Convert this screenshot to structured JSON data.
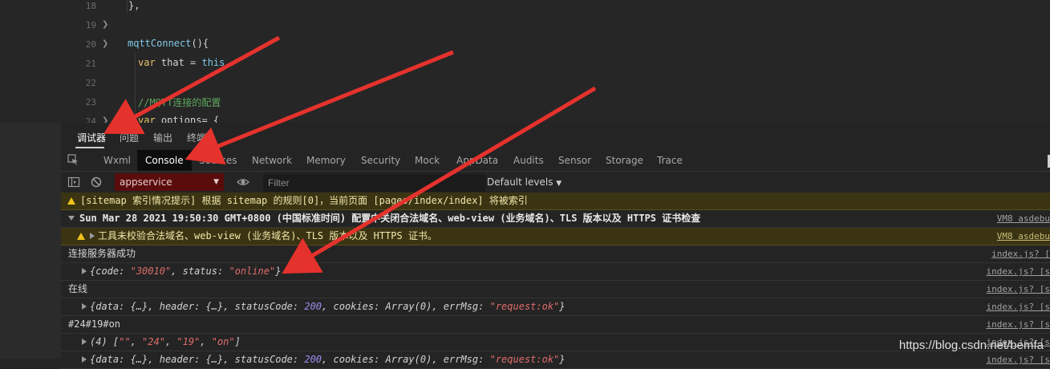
{
  "editor": {
    "lines": [
      {
        "num": "18",
        "fold": false
      },
      {
        "num": "19",
        "fold": true
      },
      {
        "num": "20",
        "fold": true
      },
      {
        "num": "21",
        "fold": false
      },
      {
        "num": "22",
        "fold": false
      },
      {
        "num": "23",
        "fold": false
      },
      {
        "num": "24",
        "fold": true
      }
    ],
    "code_18": "},",
    "code_20_name": "mqttConnect",
    "code_20_rest": "(){",
    "code_21_kw": "var",
    "code_21_mid": " that = ",
    "code_21_this": "this",
    "code_23": "//MQTT连接的配置",
    "code_24_kw": "var",
    "code_24_rest": " options= {"
  },
  "panel_tabs": [
    "调试器",
    "问题",
    "输出",
    "终端"
  ],
  "tool_tabs": [
    "Wxml",
    "Console",
    "Sources",
    "Network",
    "Memory",
    "Security",
    "Mock",
    "AppData",
    "Audits",
    "Sensor",
    "Storage",
    "Trace"
  ],
  "toolbar": {
    "context": "appservice",
    "filter_placeholder": "Filter",
    "levels": "Default levels"
  },
  "console": {
    "row1": "[sitemap 索引情况提示] 根据 sitemap 的规则[0]，当前页面 [pages/index/index] 将被索引",
    "row2": "Sun Mar 28 2021 19:50:30 GMT+0800 (中国标准时间) 配置中关闭合法域名、web-view (业务域名)、TLS 版本以及 HTTPS 证书检查",
    "row2_src": "VM8 asdebu",
    "row3": "工具未校验合法域名、web-view (业务域名)、TLS 版本以及 HTTPS 证书。",
    "row3_src": "VM8 asdebu",
    "row4": "连接服务器成功",
    "row4_src": "index.js? [",
    "row5_src": "index.js? [s",
    "row6": "在线",
    "row6_src": "index.js? [s",
    "row7_src": "index.js? [s",
    "row8": "#24#19#on",
    "row8_src": "index.js? [s",
    "row9_src": "index.js? [s",
    "row10_src": "index.js? [s"
  },
  "watermark": "https://blog.csdn.net/bemfa",
  "colors": {
    "warning_bg": "#3a3413",
    "context_bg": "#5a0c0c",
    "arrow": "#e5322d"
  }
}
